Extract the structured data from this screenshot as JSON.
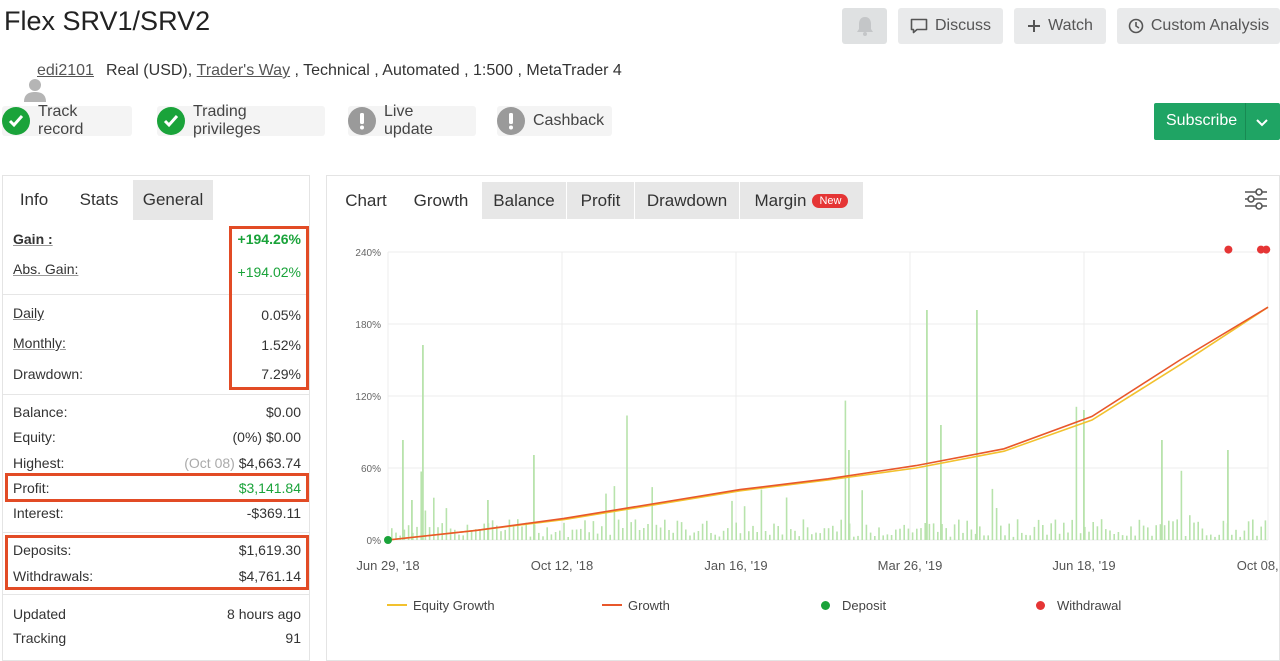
{
  "header": {
    "title": "Flex SRV1/SRV2",
    "discuss_label": "Discuss",
    "watch_label": "Watch",
    "custom_analysis_label": "Custom Analysis"
  },
  "meta": {
    "username": "edi2101",
    "account_type": "Real (USD), ",
    "broker": "Trader's Way",
    "details": " , Technical , Automated , 1:500 , MetaTrader 4"
  },
  "badges": [
    {
      "label": "Track record",
      "status": "verified",
      "color": "#1aa33a",
      "icon": "check-icon"
    },
    {
      "label": "Trading privileges",
      "status": "verified",
      "color": "#1aa33a",
      "icon": "check-icon"
    },
    {
      "label": "Live update",
      "status": "not-verified",
      "color": "#9a9a9a",
      "icon": "exclamation-icon"
    },
    {
      "label": "Cashback",
      "status": "not-verified",
      "color": "#9a9a9a",
      "icon": "exclamation-icon"
    }
  ],
  "subscribe": {
    "label": "Subscribe",
    "color": "#1fa464"
  },
  "left_tabs": [
    "Info",
    "Stats",
    "General"
  ],
  "stats": {
    "gain": {
      "label": "Gain :",
      "value": "+194.26%"
    },
    "abs_gain": {
      "label": "Abs. Gain:",
      "value": "+194.02%"
    },
    "daily": {
      "label": "Daily",
      "value": "0.05%"
    },
    "monthly": {
      "label": "Monthly:",
      "value": "1.52%"
    },
    "drawdown": {
      "label": "Drawdown:",
      "value": "7.29%"
    },
    "balance": {
      "label": "Balance:",
      "value": "$0.00"
    },
    "equity": {
      "label": "Equity:",
      "value": "(0%) $0.00"
    },
    "highest": {
      "label": "Highest:",
      "date": "(Oct 08)",
      "value": "$4,663.74"
    },
    "profit": {
      "label": "Profit:",
      "value": "$3,141.84"
    },
    "interest": {
      "label": "Interest:",
      "value": "-$369.11"
    },
    "deposits": {
      "label": "Deposits:",
      "value": "$1,619.30"
    },
    "withdrawals": {
      "label": "Withdrawals:",
      "value": "$4,761.14"
    },
    "updated": {
      "label": "Updated",
      "value": "8 hours ago"
    },
    "tracking": {
      "label": "Tracking",
      "value": "91"
    }
  },
  "chart_tabs": [
    "Chart",
    "Growth",
    "Balance",
    "Profit",
    "Drawdown",
    "Margin"
  ],
  "chart_new_badge": "New",
  "colors": {
    "highlight_box": "#e24b25",
    "growth": "#e8572b",
    "equity": "#f2c12e",
    "bars": "#b8e3ac",
    "deposit": "#1aa33a",
    "withdrawal": "#e53535"
  },
  "chart_data": {
    "type": "line",
    "y_ticks": [
      "0%",
      "60%",
      "120%",
      "180%",
      "240%"
    ],
    "ylim": [
      0,
      240
    ],
    "x_ticks": [
      "Jun 29, '18",
      "Oct 12, '18",
      "Jan 16, '19",
      "Mar 26, '19",
      "Jun 18, '19",
      "Oct 08, '19"
    ],
    "legend": [
      "Equity Growth",
      "Growth",
      "Deposit",
      "Withdrawal"
    ],
    "grid": true,
    "series": [
      {
        "name": "Growth",
        "x": [
          0,
          10,
          20,
          30,
          40,
          50,
          60,
          70,
          80,
          90,
          100
        ],
        "values": [
          0,
          8,
          18,
          30,
          42,
          51,
          62,
          76,
          103,
          150,
          194
        ]
      },
      {
        "name": "Equity Growth",
        "x": [
          0,
          10,
          20,
          30,
          40,
          50,
          60,
          70,
          80,
          90,
          100
        ],
        "values": [
          0,
          8,
          17,
          29,
          41,
          50,
          60,
          74,
          100,
          146,
          194
        ]
      }
    ],
    "deposit_points": [
      {
        "x": 0,
        "y": 0
      }
    ],
    "withdrawal_points": [
      {
        "x": 95.5,
        "y": 242
      },
      {
        "x": 99.2,
        "y": 242
      },
      {
        "x": 99.8,
        "y": 242
      }
    ]
  }
}
